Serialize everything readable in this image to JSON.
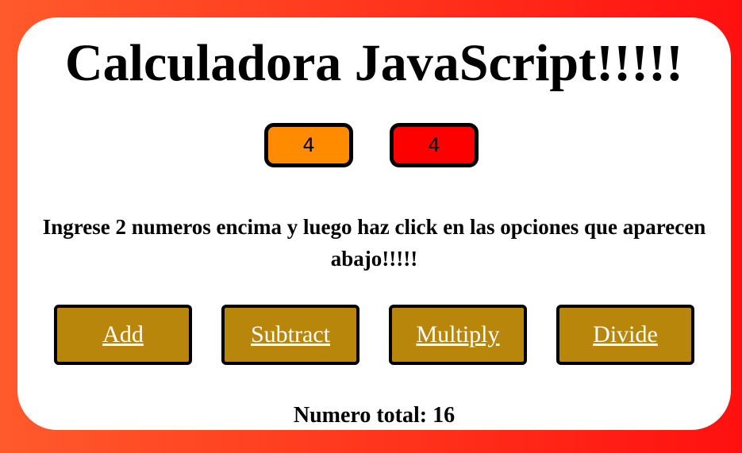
{
  "page": {
    "title": "Calculadora JavaScript!!!!!",
    "instructions": "Ingrese 2 numeros encima y luego haz click en las opciones que aparecen abajo!!!!!"
  },
  "inputs": {
    "first_value": "4",
    "second_value": "4"
  },
  "operations": {
    "add_label": "Add",
    "subtract_label": "Subtract",
    "multiply_label": "Multiply",
    "divide_label": "Divide"
  },
  "result": {
    "text": "Numero total: 16"
  },
  "colors": {
    "background_gradient_start": "#ff5a2c",
    "background_gradient_end": "#ff1010",
    "first_input_bg": "#ff8c00",
    "second_input_bg": "#ff0000",
    "button_bg": "#b8860b"
  }
}
